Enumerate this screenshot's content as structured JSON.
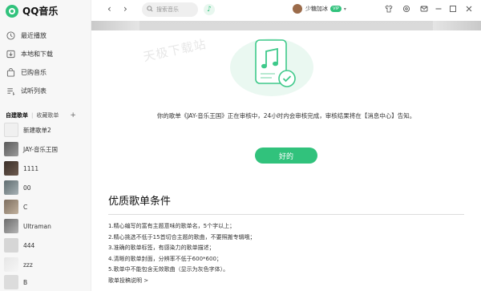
{
  "app": {
    "name": "QQ音乐"
  },
  "sidebar": {
    "nav": [
      {
        "label": "最近播放",
        "icon": "clock-icon"
      },
      {
        "label": "本地和下载",
        "icon": "download-icon"
      },
      {
        "label": "已购音乐",
        "icon": "bag-icon"
      },
      {
        "label": "试听列表",
        "icon": "list-icon"
      }
    ],
    "tabs": {
      "created": "自建歌单",
      "collected": "收藏歌单",
      "add": "+"
    },
    "playlists": [
      {
        "name": "新建歌单2",
        "color": "#f0f0f0"
      },
      {
        "name": "JAY-音乐王国",
        "color": "#6a6a6a"
      },
      {
        "name": "1111",
        "color": "#4a3f3a"
      },
      {
        "name": "00",
        "color": "#7c8a8f"
      },
      {
        "name": "C",
        "color": "#9a8b7a"
      },
      {
        "name": "Ultraman",
        "color": "#8e8e8e"
      },
      {
        "name": "444",
        "color": "#d6d6d6"
      },
      {
        "name": "zzz",
        "color": "#ececec"
      },
      {
        "name": "B",
        "color": "#dcdcdc"
      }
    ]
  },
  "topbar": {
    "back": "‹",
    "forward": "›",
    "search_placeholder": "搜索音乐",
    "username": "少糖加冰",
    "vip": "VIP",
    "icons": [
      "shirt-icon",
      "settings-icon",
      "mail-icon",
      "minimize-icon",
      "fullscreen-icon",
      "close-icon"
    ]
  },
  "dialog": {
    "watermark": "天极下载站",
    "message": "你的歌单《JAY-音乐王国》正在审核中，24小时内会审核完成，审核结果将在【消息中心】告知。",
    "ok_button": "好的"
  },
  "conditions": {
    "title": "优质歌单条件",
    "items": [
      "1.精心编写的富有主题意味的歌单名，5个字以上；",
      "2.精心挑选不低于15首切合主题的歌曲，不要照搬专辑哦；",
      "3.准确的歌单标签，有感染力的歌单描述；",
      "4.清晰的歌单封面，分辨率不低于600*600；",
      "5.歌单中不能包含无效歌曲（显示为灰色字体）。",
      "歌单投稿说明 >"
    ]
  },
  "colors": {
    "accent": "#31c27c"
  }
}
